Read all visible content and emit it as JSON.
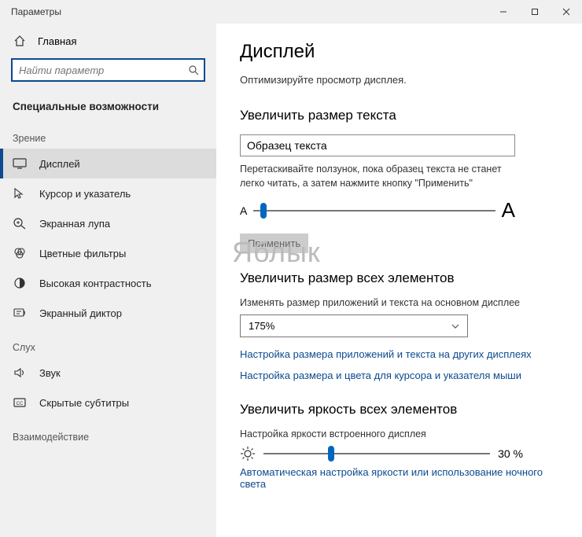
{
  "window": {
    "title": "Параметры"
  },
  "sidebar": {
    "home": "Главная",
    "search_placeholder": "Найти параметр",
    "section": "Специальные возможности",
    "groups": {
      "vision": "Зрение",
      "hearing": "Слух",
      "interaction": "Взаимодействие"
    },
    "items": {
      "display": "Дисплей",
      "cursor": "Курсор и указатель",
      "magnifier": "Экранная лупа",
      "color_filters": "Цветные фильтры",
      "high_contrast": "Высокая контрастность",
      "narrator": "Экранный диктор",
      "audio": "Звук",
      "captions": "Скрытые субтитры"
    }
  },
  "main": {
    "title": "Дисплей",
    "intro": "Оптимизируйте просмотр дисплея.",
    "text_size": {
      "heading": "Увеличить размер текста",
      "sample": "Образец текста",
      "hint": "Перетаскивайте ползунок, пока образец текста не станет легко читать, а затем нажмите кнопку \"Применить\"",
      "small_a": "A",
      "big_a": "A",
      "apply": "Применить"
    },
    "scale": {
      "heading": "Увеличить размер всех элементов",
      "label": "Изменять размер приложений и текста на основном дисплее",
      "value": "175%",
      "link_other": "Настройка размера приложений и текста на других дисплеях",
      "link_cursor": "Настройка размера и цвета для курсора и указателя мыши"
    },
    "brightness": {
      "heading": "Увеличить яркость всех элементов",
      "label": "Настройка яркости встроенного дисплея",
      "percent": "30 %",
      "link_auto": "Автоматическая настройка яркости или использование ночного света"
    }
  },
  "watermark": "Яблык"
}
